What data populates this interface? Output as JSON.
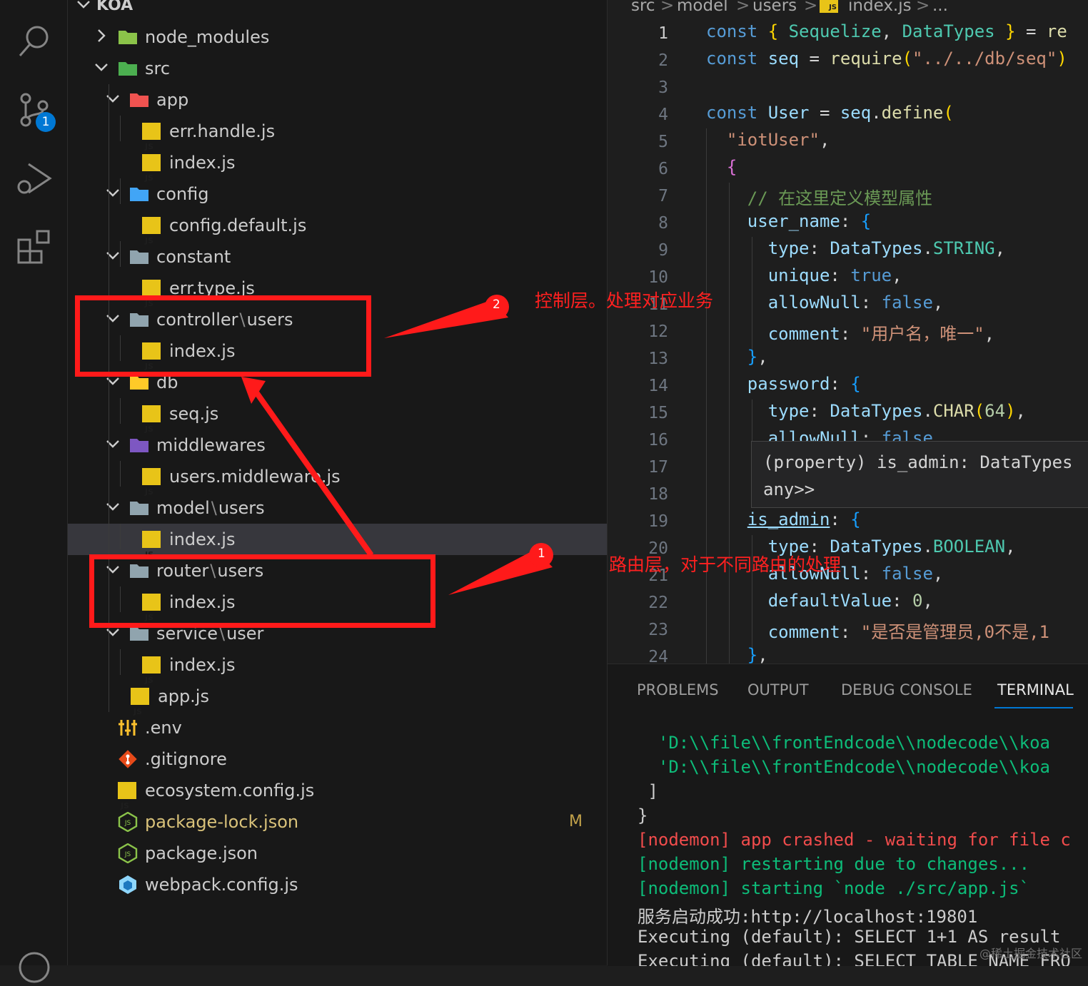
{
  "explorer": {
    "root": "KOA",
    "rows": [
      {
        "label": "node_modules",
        "sep": "",
        "sub": "",
        "icon": "node-modules-folder-icon",
        "color": "#8bc34a",
        "depth": 1,
        "chev": "right",
        "type": "folder"
      },
      {
        "label": "src",
        "sep": "",
        "sub": "",
        "icon": "src-folder-icon",
        "color": "#4caf50",
        "depth": 1,
        "chev": "down",
        "type": "folder"
      },
      {
        "label": "app",
        "sep": "",
        "sub": "",
        "icon": "app-folder-icon",
        "color": "#ef5350",
        "depth": 2,
        "chev": "down",
        "type": "folder"
      },
      {
        "label": "err.handle.js",
        "sep": "",
        "sub": "",
        "icon": "js-file-icon",
        "depth": 3,
        "chev": "",
        "type": "js"
      },
      {
        "label": "index.js",
        "sep": "",
        "sub": "",
        "icon": "js-file-icon",
        "depth": 3,
        "chev": "",
        "type": "js"
      },
      {
        "label": "config",
        "sep": "",
        "sub": "",
        "icon": "config-folder-icon",
        "color": "#42a5f5",
        "depth": 2,
        "chev": "down",
        "type": "folder"
      },
      {
        "label": "config.default.js",
        "sep": "",
        "sub": "",
        "icon": "js-file-icon",
        "depth": 3,
        "chev": "",
        "type": "js"
      },
      {
        "label": "constant",
        "sep": "",
        "sub": "",
        "icon": "constant-folder-icon",
        "color": "#90a4ae",
        "depth": 2,
        "chev": "down",
        "type": "folder"
      },
      {
        "label": "err.type.js",
        "sep": "",
        "sub": "",
        "icon": "js-file-icon",
        "depth": 3,
        "chev": "",
        "type": "js"
      },
      {
        "label": "controller",
        "sep": "\\",
        "sub": "users",
        "icon": "folder-icon",
        "color": "#90a4ae",
        "depth": 2,
        "chev": "down",
        "type": "folder"
      },
      {
        "label": "index.js",
        "sep": "",
        "sub": "",
        "icon": "js-file-icon",
        "depth": 3,
        "chev": "",
        "type": "js"
      },
      {
        "label": "db",
        "sep": "",
        "sub": "",
        "icon": "db-folder-icon",
        "color": "#ffca28",
        "depth": 2,
        "chev": "down",
        "type": "folder"
      },
      {
        "label": "seq.js",
        "sep": "",
        "sub": "",
        "icon": "js-file-icon",
        "depth": 3,
        "chev": "",
        "type": "js"
      },
      {
        "label": "middlewares",
        "sep": "",
        "sub": "",
        "icon": "middlewares-folder-icon",
        "color": "#7e57c2",
        "depth": 2,
        "chev": "down",
        "type": "folder"
      },
      {
        "label": "users.middleware.js",
        "sep": "",
        "sub": "",
        "icon": "js-file-icon",
        "depth": 3,
        "chev": "",
        "type": "js"
      },
      {
        "label": "model",
        "sep": "\\",
        "sub": "users",
        "icon": "folder-icon",
        "color": "#90a4ae",
        "depth": 2,
        "chev": "down",
        "type": "folder"
      },
      {
        "label": "index.js",
        "sep": "",
        "sub": "",
        "icon": "js-file-icon",
        "depth": 3,
        "chev": "",
        "type": "js",
        "selected": true
      },
      {
        "label": "router",
        "sep": "\\",
        "sub": "users",
        "icon": "folder-icon",
        "color": "#90a4ae",
        "depth": 2,
        "chev": "down",
        "type": "folder"
      },
      {
        "label": "index.js",
        "sep": "",
        "sub": "",
        "icon": "js-file-icon",
        "depth": 3,
        "chev": "",
        "type": "js"
      },
      {
        "label": "service",
        "sep": "\\",
        "sub": "user",
        "icon": "folder-icon",
        "color": "#90a4ae",
        "depth": 2,
        "chev": "down",
        "type": "folder"
      },
      {
        "label": "index.js",
        "sep": "",
        "sub": "",
        "icon": "js-file-icon",
        "depth": 3,
        "chev": "",
        "type": "js"
      },
      {
        "label": "app.js",
        "sep": "",
        "sub": "",
        "icon": "js-file-icon",
        "depth": 2,
        "chev": "",
        "type": "js"
      },
      {
        "label": ".env",
        "sep": "",
        "sub": "",
        "icon": "env-file-icon",
        "color": "#fbc02d",
        "depth": 1,
        "chev": "",
        "type": "env"
      },
      {
        "label": ".gitignore",
        "sep": "",
        "sub": "",
        "icon": "git-file-icon",
        "color": "#e64a19",
        "depth": 1,
        "chev": "",
        "type": "git"
      },
      {
        "label": "ecosystem.config.js",
        "sep": "",
        "sub": "",
        "icon": "js-file-icon",
        "depth": 1,
        "chev": "",
        "type": "js"
      },
      {
        "label": "package-lock.json",
        "sep": "",
        "sub": "",
        "icon": "nodejs-file-icon",
        "color": "#8bc34a",
        "depth": 1,
        "chev": "",
        "type": "node",
        "modified": "M",
        "warn": true
      },
      {
        "label": "package.json",
        "sep": "",
        "sub": "",
        "icon": "nodejs-file-icon",
        "color": "#8bc34a",
        "depth": 1,
        "chev": "",
        "type": "node"
      },
      {
        "label": "webpack.config.js",
        "sep": "",
        "sub": "",
        "icon": "webpack-file-icon",
        "color": "#8ed6fb",
        "depth": 1,
        "chev": "",
        "type": "webpack"
      }
    ]
  },
  "breadcrumb": [
    "src",
    "model",
    "users",
    "index.js",
    "..."
  ],
  "editor": {
    "line_numbers": [
      "1",
      "2",
      "3",
      "4",
      "5",
      "6",
      "7",
      "8",
      "9",
      "10",
      "11",
      "12",
      "13",
      "14",
      "15",
      "16",
      "17",
      "18",
      "19",
      "20",
      "21",
      "22",
      "23",
      "24"
    ],
    "hover_line1": "(property) is_admin: DataTypes",
    "hover_line2": "any>>"
  },
  "panel": {
    "tabs": [
      "PROBLEMS",
      "OUTPUT",
      "DEBUG CONSOLE",
      "TERMINAL"
    ],
    "active_tab": "TERMINAL",
    "terminal": [
      {
        "text": "  'D:\\\\file\\\\frontEndcode\\\\nodecode\\\\koa",
        "cls": "t-green2"
      },
      {
        "text": "  'D:\\\\file\\\\frontEndcode\\\\nodecode\\\\koa",
        "cls": "t-green2"
      },
      {
        "text": " ]",
        "cls": ""
      },
      {
        "text": "}",
        "cls": ""
      },
      {
        "text": "[nodemon] app crashed - waiting for file c",
        "cls": "t-red"
      },
      {
        "text": "[nodemon] restarting due to changes...",
        "cls": "t-green2"
      },
      {
        "text": "[nodemon] starting `node ./src/app.js`",
        "cls": "t-green2"
      },
      {
        "text": "服务启动成功:http://localhost:19801",
        "cls": ""
      },
      {
        "text": "Executing (default): SELECT 1+1 AS result",
        "cls": ""
      },
      {
        "text": "Executing (default): SELECT TABLE_NAME FRO",
        "cls": ""
      }
    ]
  },
  "activity": {
    "badge": "1"
  },
  "annotations": {
    "label1": "路由层，对于不同路由的处理",
    "label2": "控制层。处理对应业务",
    "num1": "1",
    "num2": "2",
    "red": "#ff1a1a"
  },
  "watermark": "@稀土掘金技术社区"
}
